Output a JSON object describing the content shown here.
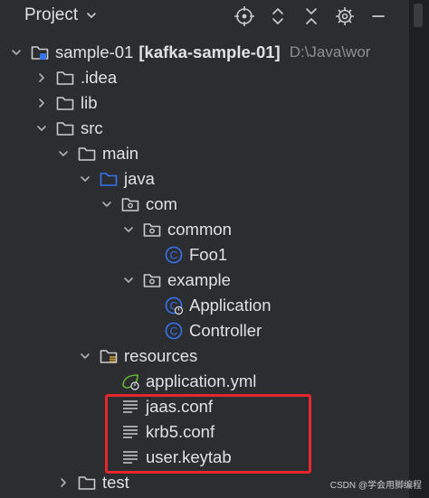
{
  "header": {
    "title": "Project"
  },
  "tree": [
    {
      "id": "sample",
      "label": "sample-01",
      "module": "[kafka-sample-01]",
      "path": "D:\\Java\\wor",
      "icon": "module-folder-icon",
      "chevron": "down"
    },
    {
      "id": "idea",
      "label": ".idea",
      "icon": "folder-icon",
      "chevron": "right"
    },
    {
      "id": "lib",
      "label": "lib",
      "icon": "folder-icon",
      "chevron": "right"
    },
    {
      "id": "src",
      "label": "src",
      "icon": "folder-icon",
      "chevron": "down"
    },
    {
      "id": "main",
      "label": "main",
      "icon": "folder-icon",
      "chevron": "down"
    },
    {
      "id": "java",
      "label": "java",
      "icon": "source-folder-icon",
      "chevron": "down"
    },
    {
      "id": "com",
      "label": "com",
      "icon": "package-icon",
      "chevron": "down"
    },
    {
      "id": "common",
      "label": "common",
      "icon": "package-icon",
      "chevron": "down"
    },
    {
      "id": "foo1",
      "label": "Foo1",
      "icon": "class-icon",
      "chevron": ""
    },
    {
      "id": "example",
      "label": "example",
      "icon": "package-icon",
      "chevron": "down"
    },
    {
      "id": "application",
      "label": "Application",
      "icon": "spring-class-icon",
      "chevron": ""
    },
    {
      "id": "controller",
      "label": "Controller",
      "icon": "class-icon",
      "chevron": ""
    },
    {
      "id": "resources",
      "label": "resources",
      "icon": "resources-folder-icon",
      "chevron": "down"
    },
    {
      "id": "appyml",
      "label": "application.yml",
      "icon": "spring-config-icon",
      "chevron": ""
    },
    {
      "id": "jaas",
      "label": "jaas.conf",
      "icon": "text-file-icon",
      "chevron": ""
    },
    {
      "id": "krb5",
      "label": "krb5.conf",
      "icon": "text-file-icon",
      "chevron": ""
    },
    {
      "id": "keytab",
      "label": "user.keytab",
      "icon": "text-file-icon",
      "chevron": ""
    },
    {
      "id": "test",
      "label": "test",
      "icon": "folder-icon",
      "chevron": "right"
    }
  ],
  "watermark": "CSDN @学会用脚编程",
  "colors": {
    "background": "#2b2d30",
    "text": "#dfe1e5",
    "path": "#8c8f94",
    "accent": "#3574f0",
    "spring": "#5fb832",
    "highlight": "#e8262d"
  }
}
